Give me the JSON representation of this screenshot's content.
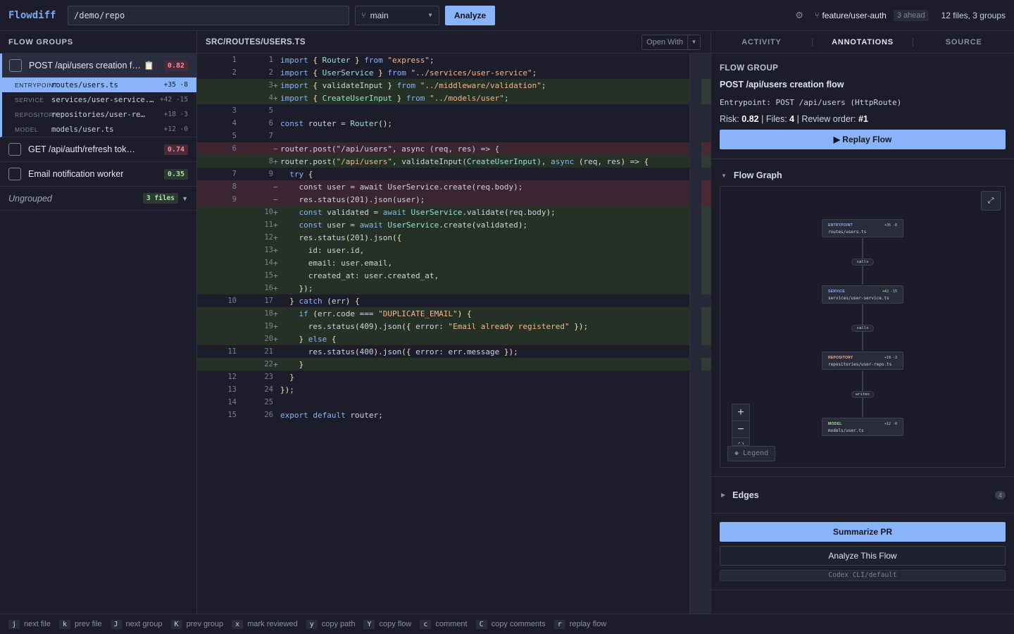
{
  "app": {
    "logo": "Flowdiff",
    "repo_path": "/demo/repo",
    "branch": "main",
    "analyze_label": "Analyze",
    "feature_branch": "feature/user-auth",
    "ahead": "3 ahead",
    "summary": "12 files, 3 groups"
  },
  "sidebar": {
    "title": "FLOW GROUPS",
    "groups": [
      {
        "name": "POST /api/users creation flow",
        "risk": "0.82",
        "files": [
          {
            "role": "ENTRYPOINT",
            "path": "routes/users.ts",
            "stats": "+35 -8"
          },
          {
            "role": "SERVICE",
            "path": "services/user-service.ts",
            "stats": "+42 -15"
          },
          {
            "role": "REPOSITORY",
            "path": "repositories/user-repo.ts",
            "stats": "+18 -3"
          },
          {
            "role": "MODEL",
            "path": "models/user.ts",
            "stats": "+12 -0"
          }
        ]
      },
      {
        "name": "GET /api/auth/refresh token flow",
        "risk": "0.74"
      },
      {
        "name": "Email notification worker",
        "risk": "0.35"
      }
    ],
    "ungrouped": {
      "label": "Ungrouped",
      "badge": "3 files"
    }
  },
  "editor": {
    "title": "SRC/ROUTES/USERS.TS",
    "open_with": "Open With",
    "lines": [
      {
        "old": "1",
        "new": "1",
        "sign": "",
        "type": "ctx",
        "html": "<span class='kw'>import</span> <span class='pn'>{</span> <span class='ty'>Router</span> <span class='pn'>}</span> <span class='kw'>from</span> <span class='st'>\"express\"</span>;"
      },
      {
        "old": "2",
        "new": "2",
        "sign": "",
        "type": "ctx",
        "html": "<span class='kw'>import</span> <span class='pn'>{</span> <span class='ty'>UserService</span> <span class='pn'>}</span> <span class='kw'>from</span> <span class='st'>\"../services/user-service\"</span>;"
      },
      {
        "old": "",
        "new": "3",
        "sign": "+",
        "type": "add",
        "html": "<span class='kw'>import</span> <span class='pn'>{</span> validateInput <span class='pn'>}</span> <span class='kw'>from</span> <span class='st'>\"../middleware/validation\"</span>;"
      },
      {
        "old": "",
        "new": "4",
        "sign": "+",
        "type": "add",
        "html": "<span class='kw'>import</span> <span class='pn'>{</span> <span class='ty'>CreateUserInput</span> <span class='pn'>}</span> <span class='kw'>from</span> <span class='st'>\"../models/user\"</span>;"
      },
      {
        "old": "3",
        "new": "5",
        "sign": "",
        "type": "ctx",
        "html": ""
      },
      {
        "old": "4",
        "new": "6",
        "sign": "",
        "type": "ctx",
        "html": "<span class='kw'>const</span> router = <span class='ty'>Router</span><span class='pn'>()</span>;"
      },
      {
        "old": "5",
        "new": "7",
        "sign": "",
        "type": "ctx",
        "html": ""
      },
      {
        "old": "6",
        "new": "",
        "sign": "−",
        "type": "del",
        "html": "router.post(\"/api/users\", async (req, res) =&gt; {"
      },
      {
        "old": "",
        "new": "8",
        "sign": "+",
        "type": "add",
        "html": "router.post(<span class='st'>\"/api/users\"</span>, validateInput(<span class='ty'>CreateUserInput</span>), <span class='kw'>async</span> <span class='pn'>(</span>req, res<span class='pn'>)</span> =&gt; <span class='pn'>{</span>"
      },
      {
        "old": "7",
        "new": "9",
        "sign": "",
        "type": "ctx",
        "html": "  <span class='kw'>try</span> <span class='pn'>{</span>"
      },
      {
        "old": "8",
        "new": "",
        "sign": "−",
        "type": "del",
        "html": "    const user = await UserService.create(req.body);"
      },
      {
        "old": "9",
        "new": "",
        "sign": "−",
        "type": "del",
        "html": "    res.status(201).json(user);"
      },
      {
        "old": "",
        "new": "10",
        "sign": "+",
        "type": "add",
        "html": "    <span class='kw'>const</span> validated = <span class='kw'>await</span> <span class='ty'>UserService</span>.validate<span class='pn'>(</span>req.body<span class='pn'>)</span>;"
      },
      {
        "old": "",
        "new": "11",
        "sign": "+",
        "type": "add",
        "html": "    <span class='kw'>const</span> user = <span class='kw'>await</span> <span class='ty'>UserService</span>.create<span class='pn'>(</span>validated<span class='pn'>)</span>;"
      },
      {
        "old": "",
        "new": "12",
        "sign": "+",
        "type": "add",
        "html": "    res.status<span class='pn'>(</span>201<span class='pn'>)</span>.json<span class='pn'>({</span>"
      },
      {
        "old": "",
        "new": "13",
        "sign": "+",
        "type": "add",
        "html": "      id: user.id,"
      },
      {
        "old": "",
        "new": "14",
        "sign": "+",
        "type": "add",
        "html": "      email: user.email,"
      },
      {
        "old": "",
        "new": "15",
        "sign": "+",
        "type": "add",
        "html": "      created_at: user.created_at,"
      },
      {
        "old": "",
        "new": "16",
        "sign": "+",
        "type": "add",
        "html": "    <span class='pn'>})</span>;"
      },
      {
        "old": "10",
        "new": "17",
        "sign": "",
        "type": "ctx",
        "html": "  <span class='pn'>}</span> <span class='kw'>catch</span> <span class='pn'>(</span>err<span class='pn'>)</span> <span class='pn'>{</span>"
      },
      {
        "old": "",
        "new": "18",
        "sign": "+",
        "type": "add",
        "html": "    <span class='kw'>if</span> <span class='pn'>(</span>err.code === <span class='st'>\"DUPLICATE_EMAIL\"</span><span class='pn'>)</span> <span class='pn'>{</span>"
      },
      {
        "old": "",
        "new": "19",
        "sign": "+",
        "type": "add",
        "html": "      res.status<span class='pn'>(</span>409<span class='pn'>)</span>.json<span class='pn'>({</span> error: <span class='st'>\"Email already registered\"</span> <span class='pn'>})</span>;"
      },
      {
        "old": "",
        "new": "20",
        "sign": "+",
        "type": "add",
        "html": "    <span class='pn'>}</span> <span class='kw'>else</span> <span class='pn'>{</span>"
      },
      {
        "old": "11",
        "new": "21",
        "sign": "",
        "type": "ctx",
        "html": "      res.status<span class='pn'>(</span>400<span class='pn'>)</span>.json<span class='pn'>({</span> error: err.message <span class='pn'>})</span>;"
      },
      {
        "old": "",
        "new": "22",
        "sign": "+",
        "type": "add",
        "html": "    <span class='pn'>}</span>"
      },
      {
        "old": "12",
        "new": "23",
        "sign": "",
        "type": "ctx",
        "html": "  <span class='pn'>}</span>"
      },
      {
        "old": "13",
        "new": "24",
        "sign": "",
        "type": "ctx",
        "html": "<span class='pn'>})</span>;"
      },
      {
        "old": "14",
        "new": "25",
        "sign": "",
        "type": "ctx",
        "html": ""
      },
      {
        "old": "15",
        "new": "26",
        "sign": "",
        "type": "ctx",
        "html": "<span class='kw'>export</span> <span class='kw'>default</span> router;"
      }
    ]
  },
  "right": {
    "tabs": [
      "ACTIVITY",
      "ANNOTATIONS",
      "SOURCE"
    ],
    "flow_group_label": "FLOW GROUP",
    "flow_name": "POST /api/users creation flow",
    "entrypoint": "Entrypoint: POST /api/users (HttpRoute)",
    "risk_label": "Risk:",
    "risk": "0.82",
    "files_label": "Files:",
    "files": "4",
    "order_label": "Review order:",
    "order": "#1",
    "replay_label": "Replay Flow",
    "graph_title": "Flow Graph",
    "legend_label": "◆ Legend",
    "graph_nodes": [
      {
        "role": "ENTRYPOINT",
        "stat": "+35 -8",
        "path": "routes/users.ts",
        "color": "#89b4fa"
      },
      {
        "role": "SERVICE",
        "stat": "+42 -15",
        "path": "services/user-service.ts",
        "color": "#89b4fa"
      },
      {
        "role": "REPOSITORY",
        "stat": "+18 -3",
        "path": "repositories/user-repo.ts",
        "color": "#fab387"
      },
      {
        "role": "MODEL",
        "stat": "+12 -0",
        "path": "models/user.ts",
        "color": "#a6e3a1"
      }
    ],
    "graph_edges": [
      "calls",
      "calls",
      "writes"
    ],
    "edges_title": "Edges",
    "edges_count": "4",
    "summarize_label": "Summarize PR",
    "analyze_flow_label": "Analyze This Flow",
    "model_select": "Codex CLI/default"
  },
  "footer": {
    "shortcuts": [
      {
        "key": "j",
        "label": "next file"
      },
      {
        "key": "k",
        "label": "prev file"
      },
      {
        "key": "J",
        "label": "next group"
      },
      {
        "key": "K",
        "label": "prev group"
      },
      {
        "key": "x",
        "label": "mark reviewed"
      },
      {
        "key": "y",
        "label": "copy path"
      },
      {
        "key": "Y",
        "label": "copy flow"
      },
      {
        "key": "c",
        "label": "comment"
      },
      {
        "key": "C",
        "label": "copy comments"
      },
      {
        "key": "r",
        "label": "replay flow"
      }
    ]
  }
}
